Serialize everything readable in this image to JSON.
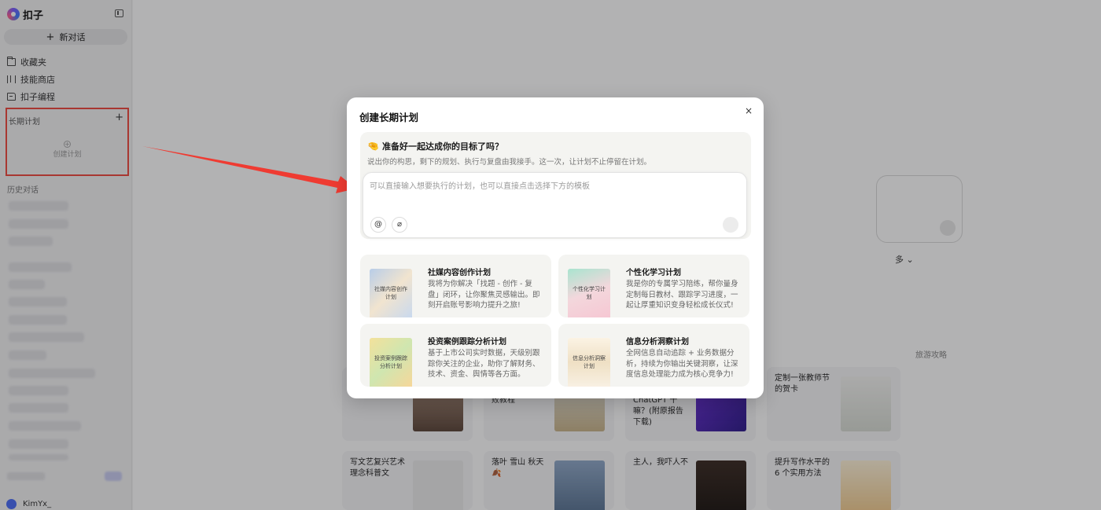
{
  "sidebar": {
    "brand": "扣子",
    "new_chat": "新对话",
    "nav": [
      {
        "label": "收藏夹",
        "icon": "folder-icon"
      },
      {
        "label": "技能商店",
        "icon": "shop-icon"
      },
      {
        "label": "扣子编程",
        "icon": "code-icon"
      }
    ],
    "long_term": {
      "title": "长期计划",
      "add": "+",
      "create": "创建计划"
    },
    "history_title": "历史对话",
    "user": "KimYx_"
  },
  "background": {
    "more": "多 ⌄",
    "tab": "旅游攻略",
    "cards": [
      {
        "text": ""
      },
      {
        "text": "败教程"
      },
      {
        "text": "ChatGPT 干嘛？(附原报告下载)"
      },
      {
        "text": "定制一张教师节的贺卡"
      },
      {
        "text": "写文艺复兴艺术理念科普文"
      },
      {
        "text": "落叶 雪山 秋天🍂"
      },
      {
        "text": "主人，我吓人不"
      },
      {
        "text": "提升写作水平的 6 个实用方法"
      }
    ]
  },
  "modal": {
    "title": "创建长期计划",
    "close": "×",
    "intro_emoji": "🤏",
    "intro_title": "准备好一起达成你的目标了吗？",
    "intro_sub": "说出你的构思，剩下的规划、执行与复盘由我接手。这一次，让计划不止停留在计划。",
    "input_placeholder": "可以直接输入想要执行的计划，也可以直接点击选择下方的模板",
    "at_symbol": "@",
    "attach_symbol": "⌀",
    "templates": [
      {
        "title": "社媒内容创作计划",
        "desc": "我将为你解决「找题 - 创作 - 复盘」闭环，让你聚焦灵感输出。即刻开启账号影响力提升之旅!",
        "thumb": "社媒内容创作计划"
      },
      {
        "title": "个性化学习计划",
        "desc": "我是你的专属学习陪练，帮你量身定制每日教材、跟踪学习进度，一起让厚重知识变身轻松成长仪式!",
        "thumb": "个性化学习计划"
      },
      {
        "title": "投资案例跟踪分析计划",
        "desc": "基于上市公司实时数据，天级别跟踪你关注的企业，助你了解财务、技术、资金、舆情等各方面。",
        "thumb": "投资案例跟踪分析计划"
      },
      {
        "title": "信息分析洞察计划",
        "desc": "全网信息自动追踪 + 业务数据分析，持续为你输出关键洞察，让深度信息处理能力成为核心竞争力!",
        "thumb": "信息分析洞察计划"
      }
    ]
  },
  "colors": {
    "highlight": "#f0483e",
    "arrow": "#ef3b32"
  }
}
